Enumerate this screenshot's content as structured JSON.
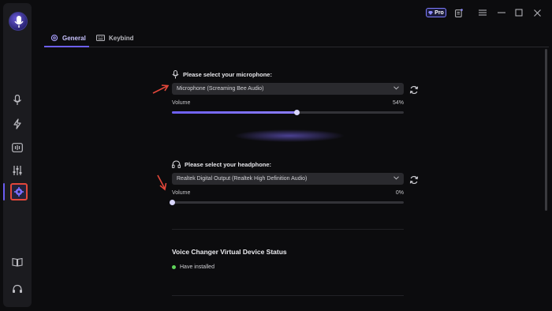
{
  "titlebar": {
    "pro_badge": "Pro",
    "icons": [
      "pro-badge-icon",
      "notes-icon",
      "menu-icon",
      "minimize-icon",
      "maximize-icon",
      "close-icon"
    ]
  },
  "sidebar": {
    "items": [
      {
        "icon": "microphone-icon"
      },
      {
        "icon": "lightning-icon"
      },
      {
        "icon": "soundboard-icon"
      },
      {
        "icon": "equalizer-icon"
      },
      {
        "icon": "settings-icon",
        "active": true
      },
      {
        "icon": "book-icon"
      },
      {
        "icon": "headset-support-icon"
      }
    ]
  },
  "tabs": [
    {
      "label": "General",
      "icon": "gear-icon",
      "active": true
    },
    {
      "label": "Keybind",
      "icon": "keyboard-icon"
    }
  ],
  "microphone": {
    "label": "Please select your microphone:",
    "selected": "Microphone (Screaming Bee Audio)",
    "volume_label": "Volume",
    "volume_value": "54%",
    "volume_fraction": 0.54
  },
  "headphone": {
    "label": "Please select your headphone:",
    "selected": "Realtek Digital Output (Realtek High Definition Audio)",
    "volume_label": "Volume",
    "volume_value": "0%",
    "volume_fraction": 0.0
  },
  "virtual_device": {
    "title": "Voice Changer Virtual Device Status",
    "status": "Have installed",
    "status_color": "#5fd35a"
  },
  "colors": {
    "accent": "#6d5ff2",
    "annotation": "#e2473a"
  }
}
